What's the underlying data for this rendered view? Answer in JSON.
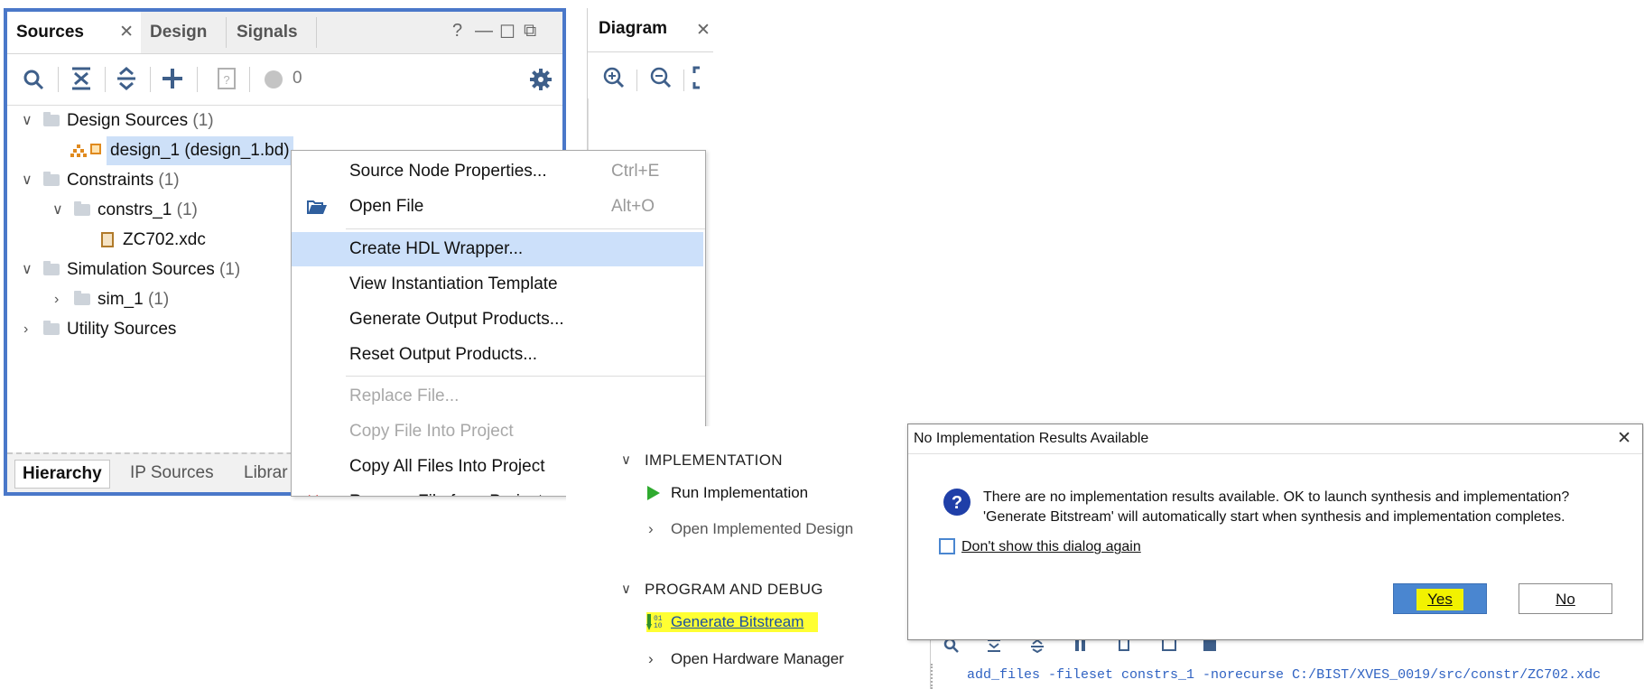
{
  "sources_panel": {
    "tabs": [
      {
        "label": "Sources",
        "active": true
      },
      {
        "label": "Design",
        "active": false
      },
      {
        "label": "Signals",
        "active": false
      }
    ],
    "window_controls": {
      "help": "?",
      "minimize": "—",
      "maximize": "☐",
      "float": "⧉"
    },
    "toolbar": {
      "badge_count": "0"
    },
    "tree": [
      {
        "label": "Design Sources",
        "count": "(1)"
      },
      {
        "label": "design_1 (design_1.bd)",
        "count": ""
      },
      {
        "label": "Constraints",
        "count": "(1)"
      },
      {
        "label": "constrs_1",
        "count": "(1)"
      },
      {
        "label": "ZC702.xdc",
        "count": ""
      },
      {
        "label": "Simulation Sources",
        "count": "(1)"
      },
      {
        "label": "sim_1",
        "count": "(1)"
      },
      {
        "label": "Utility Sources",
        "count": ""
      }
    ],
    "bottom_tabs": [
      "Hierarchy",
      "IP Sources",
      "Librar"
    ]
  },
  "diagram_panel": {
    "tab": "Diagram"
  },
  "context_menu": {
    "items": [
      {
        "label": "Source Node Properties...",
        "shortcut": "Ctrl+E"
      },
      {
        "label": "Open File",
        "shortcut": "Alt+O"
      },
      {
        "label": "Create HDL Wrapper...",
        "shortcut": ""
      },
      {
        "label": "View Instantiation Template",
        "shortcut": ""
      },
      {
        "label": "Generate Output Products...",
        "shortcut": ""
      },
      {
        "label": "Reset Output Products...",
        "shortcut": ""
      },
      {
        "label": "Replace File...",
        "shortcut": ""
      },
      {
        "label": "Copy File Into Project",
        "shortcut": ""
      },
      {
        "label": "Copy All Files Into Project",
        "shortcut": ""
      },
      {
        "label": "Remove File from Project...",
        "shortcut": ""
      }
    ]
  },
  "flow_navigator": {
    "implementation": {
      "heading": "IMPLEMENTATION",
      "run": "Run Implementation",
      "open": "Open Implemented Design"
    },
    "program_debug": {
      "heading": "PROGRAM AND DEBUG",
      "generate": "Generate Bitstream",
      "hardware": "Open Hardware Manager"
    }
  },
  "dialog": {
    "title": "No Implementation Results Available",
    "line1": "There are no implementation results available. OK to launch synthesis and implementation?",
    "line2": "'Generate Bitstream' will automatically start when synthesis and implementation completes.",
    "checkbox_label": "Don't show this dialog again",
    "yes": "Yes",
    "no": "No",
    "close": "✕",
    "accent": "#4a86d0"
  },
  "console": {
    "command": "add_files -fileset constrs_1 -norecurse C:/BIST/XVES_0019/src/constr/ZC702.xdc"
  }
}
